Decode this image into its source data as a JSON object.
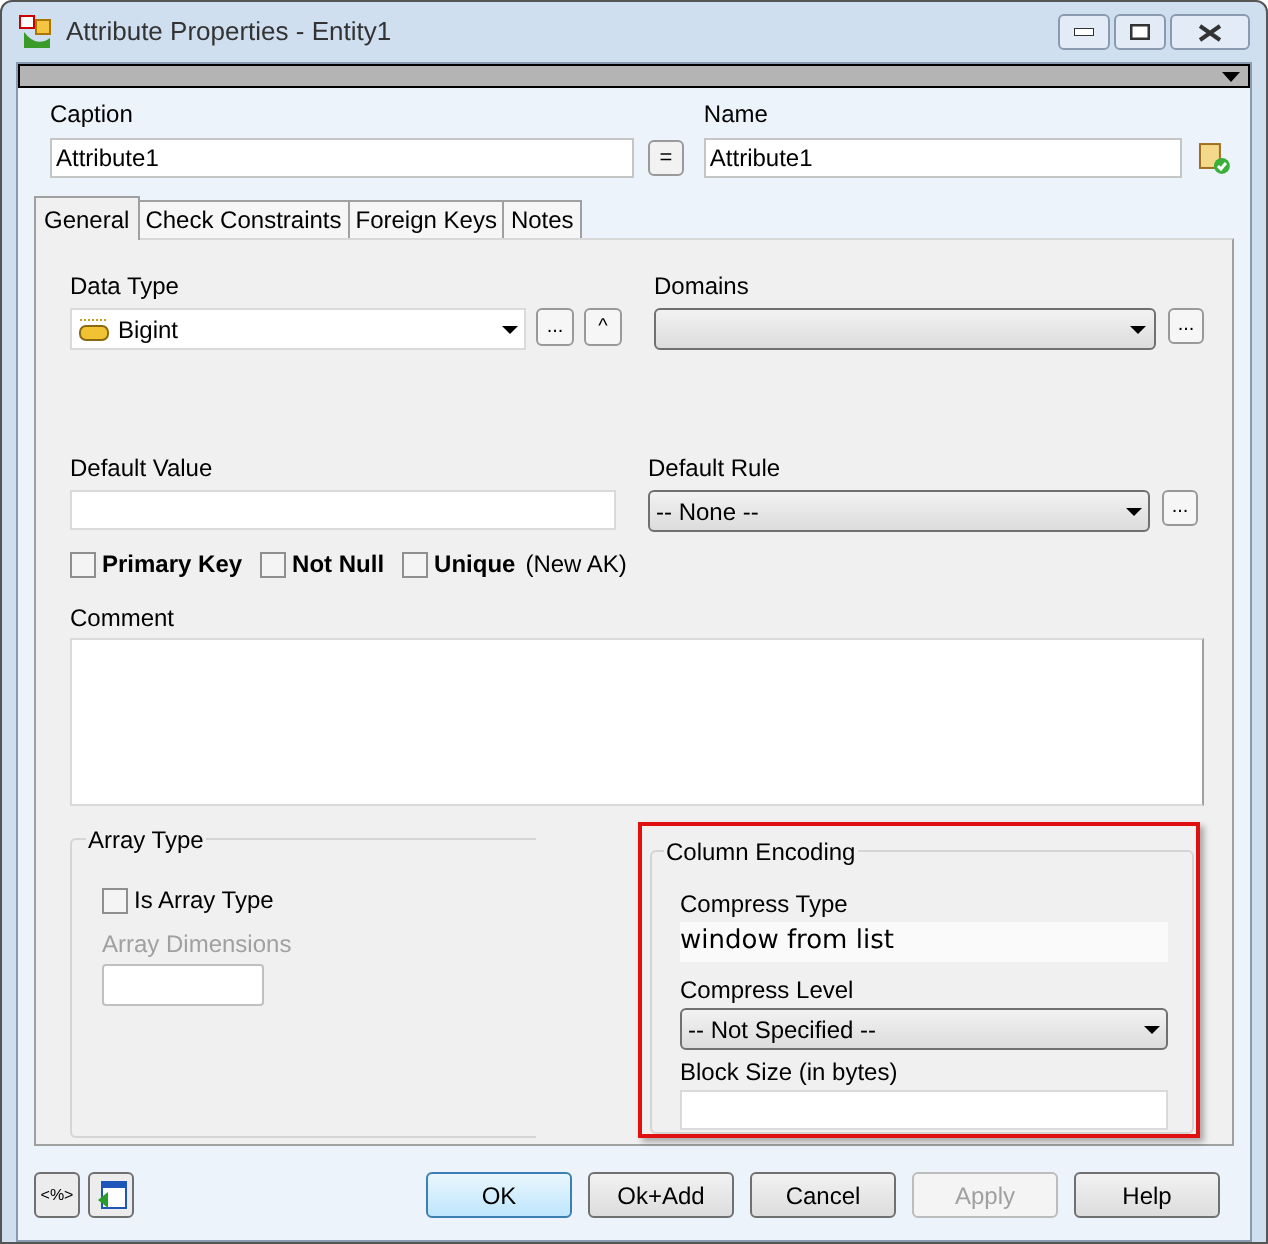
{
  "window": {
    "title": "Attribute Properties - Entity1"
  },
  "caption": {
    "label": "Caption",
    "value": "Attribute1"
  },
  "equal_button": "=",
  "name": {
    "label": "Name",
    "value": "Attribute1"
  },
  "tabs": [
    {
      "label": "General",
      "selected": true
    },
    {
      "label": "Check Constraints",
      "selected": false
    },
    {
      "label": "Foreign Keys",
      "selected": false
    },
    {
      "label": "Notes",
      "selected": false
    }
  ],
  "data_type": {
    "label": "Data Type",
    "value": "Bigint",
    "browse_button": "...",
    "up_button": "^"
  },
  "domains": {
    "label": "Domains",
    "browse_button": "..."
  },
  "default_value": {
    "label": "Default Value"
  },
  "default_rule": {
    "label": "Default Rule",
    "value": "-- None --",
    "browse_button": "..."
  },
  "checkboxes": [
    {
      "label": "Primary Key",
      "checked": false
    },
    {
      "label": "Not Null",
      "checked": false
    },
    {
      "label": "Unique",
      "checked": false
    }
  ],
  "new_ak": "(New AK)",
  "comment": {
    "label": "Comment"
  },
  "array_type": {
    "title": "Array Type",
    "checkbox": {
      "label": "Is Array Type",
      "checked": false
    },
    "dimensions": {
      "label": "Array Dimensions",
      "disabled": true
    }
  },
  "column_encoding": {
    "title": "Column Encoding",
    "compress_type": {
      "label": "Compress Type",
      "value": "window from list"
    },
    "compress_level": {
      "label": "Compress Level",
      "value": "-- Not Specified --"
    },
    "block_size": {
      "label": "Block Size (in bytes)"
    }
  },
  "footer_buttons": [
    {
      "label": "OK",
      "disabled": false,
      "default": true
    },
    {
      "label": "Ok+Add",
      "disabled": false,
      "default": false
    },
    {
      "label": "Cancel",
      "disabled": false,
      "default": false
    },
    {
      "label": "Apply",
      "disabled": true,
      "default": false
    },
    {
      "label": "Help",
      "disabled": false,
      "default": false
    }
  ],
  "macro_button": "<%>"
}
